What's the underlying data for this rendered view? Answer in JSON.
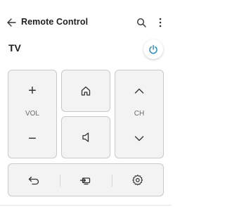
{
  "header": {
    "title": "Remote Control"
  },
  "device": {
    "name": "TV"
  },
  "remote": {
    "volume": {
      "label": "VOL",
      "up": "+",
      "down": "−"
    },
    "channel": {
      "label": "CH"
    }
  },
  "icons": {
    "back": "arrow-left-icon",
    "search": "search-icon",
    "more": "more-vert-icon",
    "power": "power-icon",
    "home": "home-icon",
    "input": "speaker-icon",
    "return": "return-icon",
    "source": "input-source-icon",
    "settings": "settings-icon"
  },
  "colors": {
    "accent": "#2f8fb6",
    "card_bg": "#f3f3f3",
    "card_border": "#c9c9c9"
  }
}
